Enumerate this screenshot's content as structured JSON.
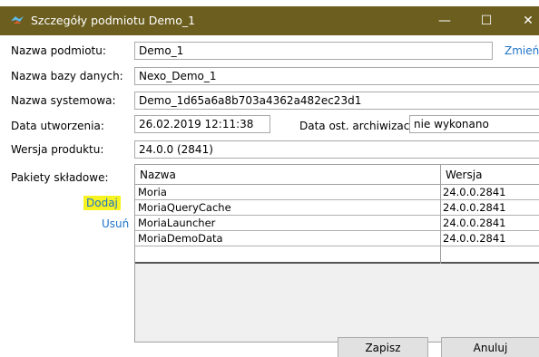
{
  "window": {
    "title": "Szczegóły podmiotu Demo_1",
    "controls": {
      "minimize": "—",
      "maximize": "☐",
      "close": "✕"
    }
  },
  "form": {
    "nazwa_podmiotu_label": "Nazwa podmiotu:",
    "nazwa_podmiotu_value": "Demo_1",
    "zmien_link": "Zmień.",
    "nazwa_bazy_label": "Nazwa bazy danych:",
    "nazwa_bazy_value": "Nexo_Demo_1",
    "nazwa_systemowa_label": "Nazwa systemowa:",
    "nazwa_systemowa_value": "Demo_1d65a6a8b703a4362a482ec23d1",
    "data_utworzenia_label": "Data utworzenia:",
    "data_utworzenia_value": "26.02.2019 12:11:38",
    "data_archiwizacji_label": "Data ost. archiwizacji:",
    "data_archiwizacji_value": "nie wykonano",
    "wersja_label": "Wersja produktu:",
    "wersja_value": "24.0.0 (2841)",
    "pakiety_label": "Pakiety składowe:",
    "dodaj_link": "Dodaj",
    "usun_link": "Usuń"
  },
  "packages": {
    "columns": [
      "Nazwa",
      "Wersja"
    ],
    "rows": [
      {
        "name": "Moria",
        "version": "24.0.0.2841"
      },
      {
        "name": "MoriaQueryCache",
        "version": "24.0.0.2841"
      },
      {
        "name": "MoriaLauncher",
        "version": "24.0.0.2841"
      },
      {
        "name": "MoriaDemoData",
        "version": "24.0.0.2841"
      }
    ]
  },
  "buttons": {
    "save": "Zapisz",
    "cancel": "Anuluj"
  },
  "colors": {
    "titlebar": "#6b5e1e",
    "link": "#1e73c8",
    "highlight": "#f7f320"
  }
}
